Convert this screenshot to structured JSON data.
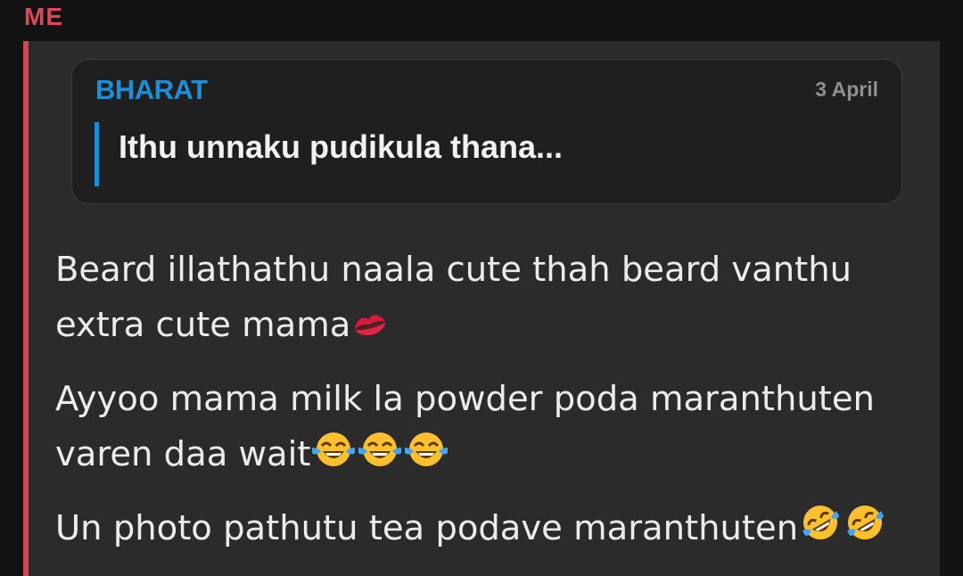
{
  "sender_label": "ME",
  "reply": {
    "name": "BHARAT",
    "date": "3 April",
    "text": "Ithu unnaku pudikula thana..."
  },
  "messages": [
    {
      "line1": "Beard illathathu naala cute thah beard vanthu",
      "line2": "extra cute mama",
      "emojis": [
        "kiss-mark-icon"
      ]
    },
    {
      "line1": "Ayyoo mama milk la powder poda maranthuten",
      "line2": "varen daa wait",
      "emojis": [
        "tears-of-joy-icon",
        "tears-of-joy-icon",
        "tears-of-joy-icon"
      ]
    },
    {
      "line1": "Un photo pathutu tea podave maranthuten",
      "emojis": [
        "rofl-icon",
        "rofl-icon"
      ]
    }
  ],
  "colors": {
    "sender": "#e0475a",
    "reply_name": "#1d8fd8",
    "bubble": "#2b2b2b",
    "background": "#121212"
  }
}
